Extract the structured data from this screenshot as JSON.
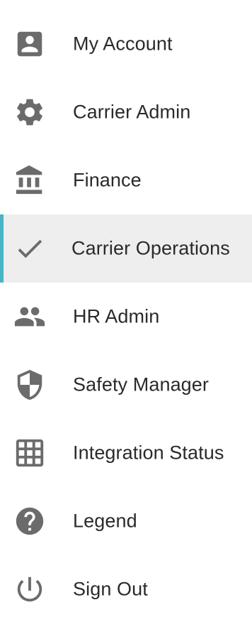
{
  "colors": {
    "icon": "#6b6b6b",
    "text": "#2a2a2a",
    "active_background": "#eeeeee",
    "active_accent": "#4ab3c6"
  },
  "menu": {
    "active_index": 3,
    "items": [
      {
        "label": "My Account",
        "icon": "account-box-icon"
      },
      {
        "label": "Carrier Admin",
        "icon": "gear-icon"
      },
      {
        "label": "Finance",
        "icon": "bank-icon"
      },
      {
        "label": "Carrier Operations",
        "icon": "checkmark-icon"
      },
      {
        "label": "HR Admin",
        "icon": "people-icon"
      },
      {
        "label": "Safety Manager",
        "icon": "shield-icon"
      },
      {
        "label": "Integration Status",
        "icon": "grid-icon"
      },
      {
        "label": "Legend",
        "icon": "help-circle-icon"
      },
      {
        "label": "Sign Out",
        "icon": "power-icon"
      }
    ]
  }
}
